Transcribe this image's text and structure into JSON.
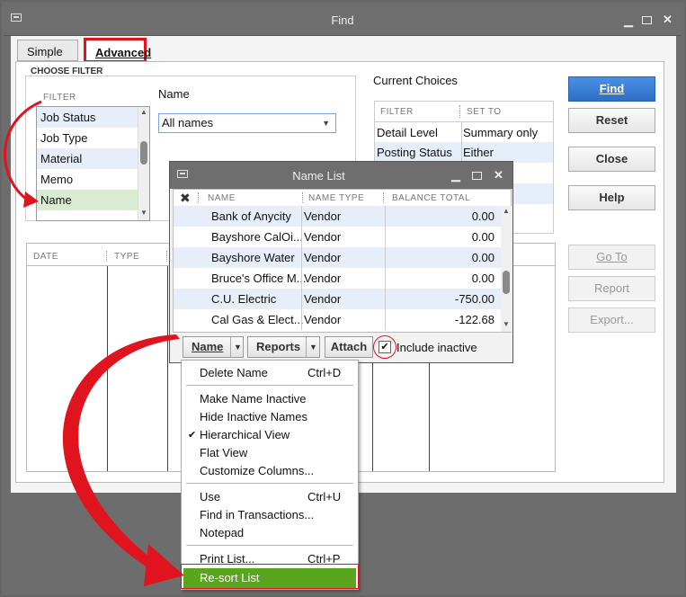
{
  "find_window": {
    "title": "Find",
    "tabs": [
      "Simple",
      "Advanced"
    ],
    "choose_filter_label": "CHOOSE FILTER",
    "filter_header": "FILTER",
    "filter_items": [
      "Job Status",
      "Job Type",
      "Material",
      "Memo",
      "Name"
    ],
    "name_label": "Name",
    "name_select_value": "All names",
    "current_choices_label": "Current Choices",
    "choices_headers": [
      "FILTER",
      "SET TO"
    ],
    "choices_rows": [
      {
        "filter": "Detail Level",
        "set_to": "Summary only"
      },
      {
        "filter": "Posting Status",
        "set_to": "Either"
      }
    ],
    "results_headers": [
      "DATE",
      "TYPE"
    ],
    "buttons": {
      "find": "Find",
      "reset": "Reset",
      "close": "Close",
      "help": "Help",
      "goto": "Go To",
      "report": "Report",
      "export": "Export..."
    }
  },
  "name_list": {
    "title": "Name List",
    "headers": [
      "NAME",
      "NAME TYPE",
      "BALANCE TOTAL"
    ],
    "rows": [
      {
        "name": "Bank of Anycity",
        "type": "Vendor",
        "balance": "0.00"
      },
      {
        "name": "Bayshore CalOi...",
        "type": "Vendor",
        "balance": "0.00"
      },
      {
        "name": "Bayshore Water",
        "type": "Vendor",
        "balance": "0.00"
      },
      {
        "name": "Bruce's Office M...",
        "type": "Vendor",
        "balance": "0.00"
      },
      {
        "name": "C.U. Electric",
        "type": "Vendor",
        "balance": "-750.00"
      },
      {
        "name": "Cal Gas & Elect...",
        "type": "Vendor",
        "balance": "-122.68"
      }
    ],
    "footer": {
      "name_btn": "Name",
      "reports_btn": "Reports",
      "attach_btn": "Attach",
      "include_inactive": "Include inactive",
      "include_inactive_checked": true
    }
  },
  "name_menu": {
    "groups": [
      [
        {
          "label": "Delete Name",
          "shortcut": "Ctrl+D"
        }
      ],
      [
        {
          "label": "Make Name Inactive",
          "shortcut": ""
        },
        {
          "label": "Hide Inactive Names",
          "shortcut": ""
        },
        {
          "label": "Hierarchical View",
          "shortcut": "",
          "checked": true
        },
        {
          "label": "Flat View",
          "shortcut": ""
        },
        {
          "label": "Customize Columns...",
          "shortcut": ""
        }
      ],
      [
        {
          "label": "Use",
          "shortcut": "Ctrl+U"
        },
        {
          "label": "Find in Transactions...",
          "shortcut": ""
        },
        {
          "label": "Notepad",
          "shortcut": ""
        }
      ],
      [
        {
          "label": "Print List...",
          "shortcut": "Ctrl+P"
        },
        {
          "label": "Re-sort List",
          "shortcut": ""
        }
      ]
    ]
  },
  "colors": {
    "highlight_red": "#e0141e",
    "find_blue": "#3a7fd6",
    "menu_green": "#5aa51e",
    "selected_row": "#dff0d8",
    "alt_row": "#e6eefa"
  }
}
